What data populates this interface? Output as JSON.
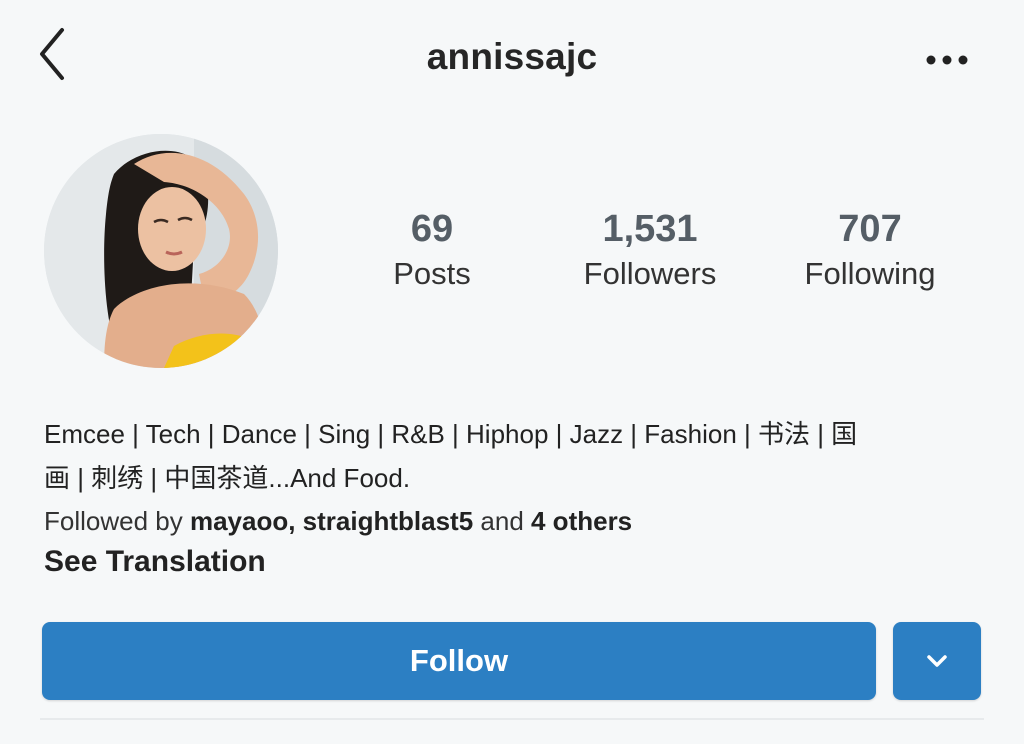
{
  "header": {
    "username": "annissajc",
    "back_icon": "chevron-left-icon",
    "more_icon": "more-horizontal-icon"
  },
  "avatar": {
    "description_icon": "profile-photo"
  },
  "stats": {
    "posts": {
      "value": "69",
      "label": "Posts"
    },
    "followers": {
      "value": "1,531",
      "label": "Followers"
    },
    "following": {
      "value": "707",
      "label": "Following"
    }
  },
  "bio": {
    "line1": "Emcee | Tech | Dance | Sing | R&B | Hiphop | Jazz | Fashion | 书法 | 国",
    "line2": "画 | 刺绣 | 中国茶道...And Food."
  },
  "followed_by": {
    "prefix": "Followed by ",
    "names": "mayaoo, straightblast5",
    "connector": " and ",
    "others": "4 others"
  },
  "see_translation": "See Translation",
  "actions": {
    "follow_label": "Follow",
    "dropdown_icon": "chevron-down-icon"
  },
  "colors": {
    "accent": "#2c7fc3",
    "background": "#f6f8f9",
    "text": "#222222",
    "stat_number": "#555e66"
  }
}
